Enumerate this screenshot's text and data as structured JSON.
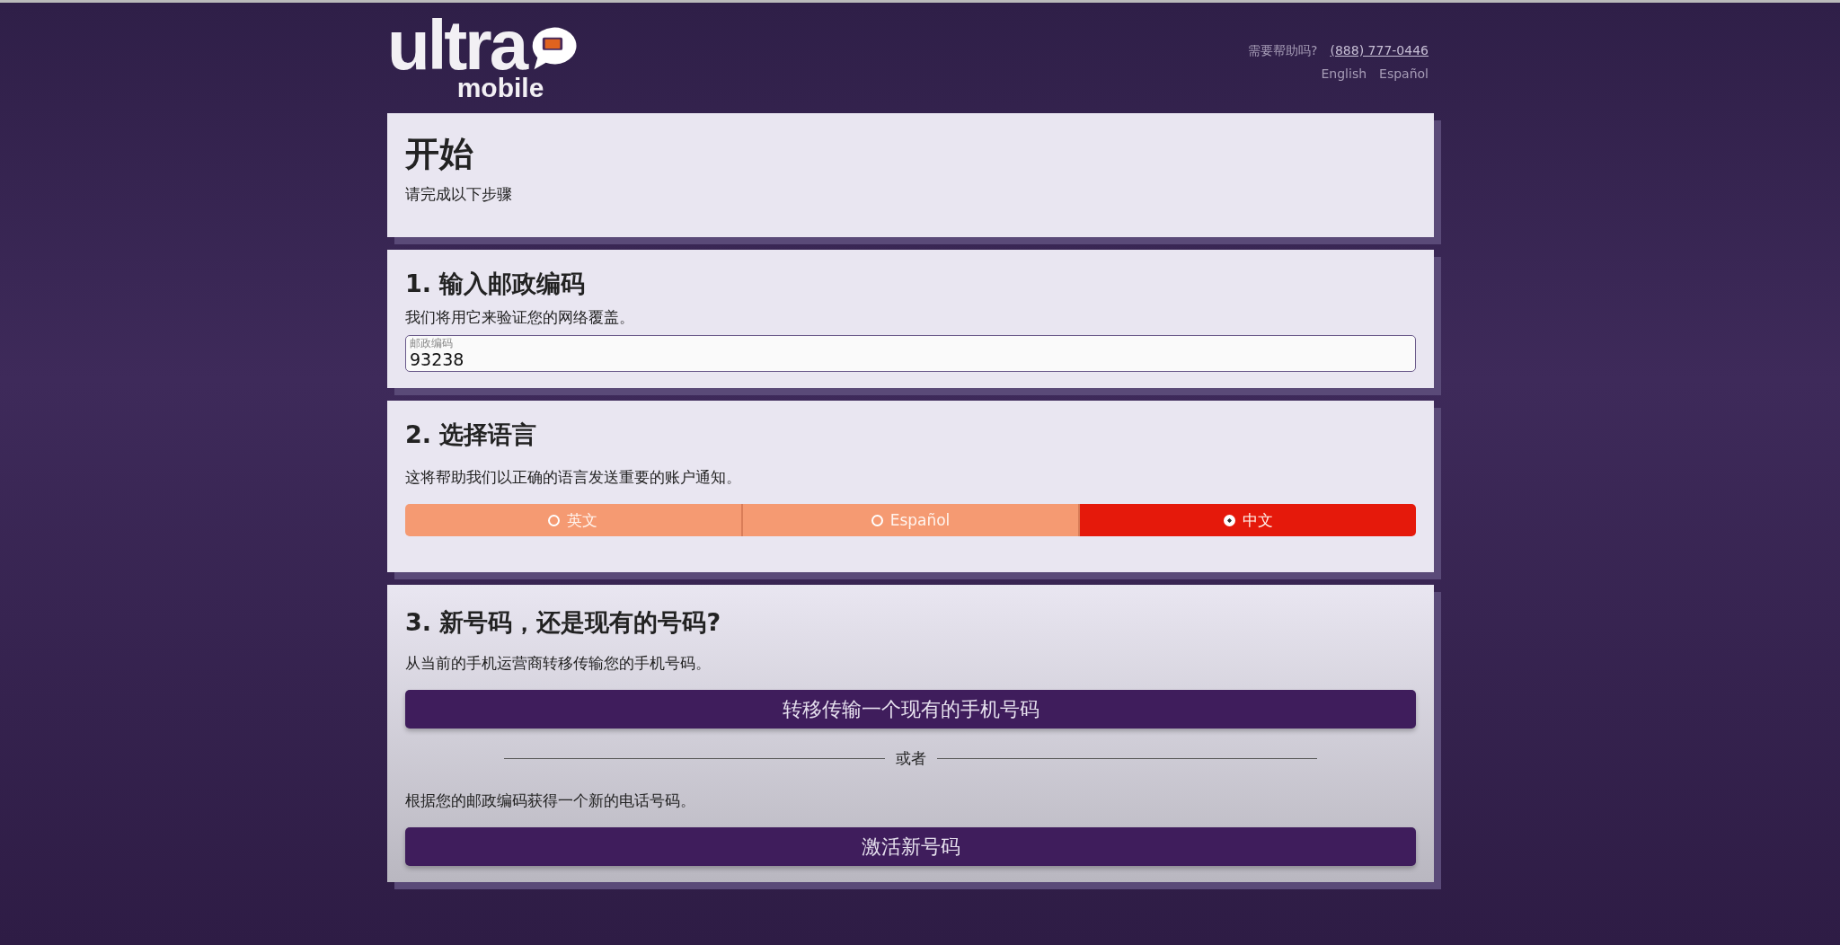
{
  "logo": {
    "wordmark": "ultra",
    "sub": "mobile"
  },
  "help": {
    "label": "需要帮助吗?",
    "phone": "(888) 777-0446"
  },
  "site_languages": [
    "English",
    "Español"
  ],
  "intro": {
    "title": "开始",
    "subtitle": "请完成以下步骤"
  },
  "step_zip": {
    "title": "1. 输入邮政编码",
    "description": "我们将用它来验证您的网络覆盖。",
    "field": {
      "label": "邮政编码",
      "value": "93238"
    }
  },
  "step_language": {
    "title": "2. 选择语言",
    "description": "这将帮助我们以正确的语言发送重要的账户通知。",
    "options": [
      {
        "label": "英文",
        "selected": false
      },
      {
        "label": "Español",
        "selected": false
      },
      {
        "label": "中文",
        "selected": true
      }
    ]
  },
  "step_number": {
    "title": "3. 新号码，还是现有的号码?",
    "port_description": "从当前的手机运营商转移传输您的手机号码。",
    "port_button": "转移传输一个现有的手机号码",
    "divider": "或者",
    "new_description": "根据您的邮政编码获得一个新的电话号码。",
    "new_button": "激活新号码"
  }
}
